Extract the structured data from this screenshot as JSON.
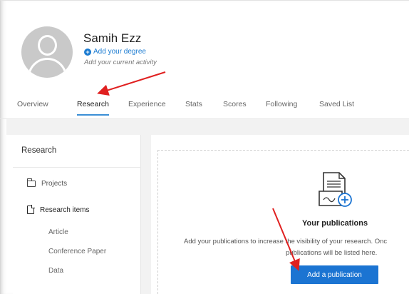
{
  "profile": {
    "name": "Samih Ezz",
    "add_degree": "Add your degree",
    "activity": "Add your current activity"
  },
  "tabs": [
    {
      "label": "Overview"
    },
    {
      "label": "Research"
    },
    {
      "label": "Experience"
    },
    {
      "label": "Stats"
    },
    {
      "label": "Scores"
    },
    {
      "label": "Following"
    },
    {
      "label": "Saved List"
    }
  ],
  "active_tab": "Research",
  "sidebar": {
    "title": "Research",
    "items": [
      {
        "label": "Projects",
        "icon": "folder-icon"
      },
      {
        "label": "Research items",
        "icon": "document-icon"
      }
    ],
    "sub_items": [
      {
        "label": "Article"
      },
      {
        "label": "Conference Paper"
      },
      {
        "label": "Data"
      }
    ]
  },
  "publications": {
    "title": "Your publications",
    "description_line1": "Add your publications to increase the visibility of your research. Onc",
    "description_line2": "publications will be listed here.",
    "button_label": "Add a publication"
  },
  "colors": {
    "accent": "#1b74d2",
    "link": "#1b7bd1",
    "annotation_arrow": "#e02020",
    "tab_underline": "#3b8fd6"
  }
}
